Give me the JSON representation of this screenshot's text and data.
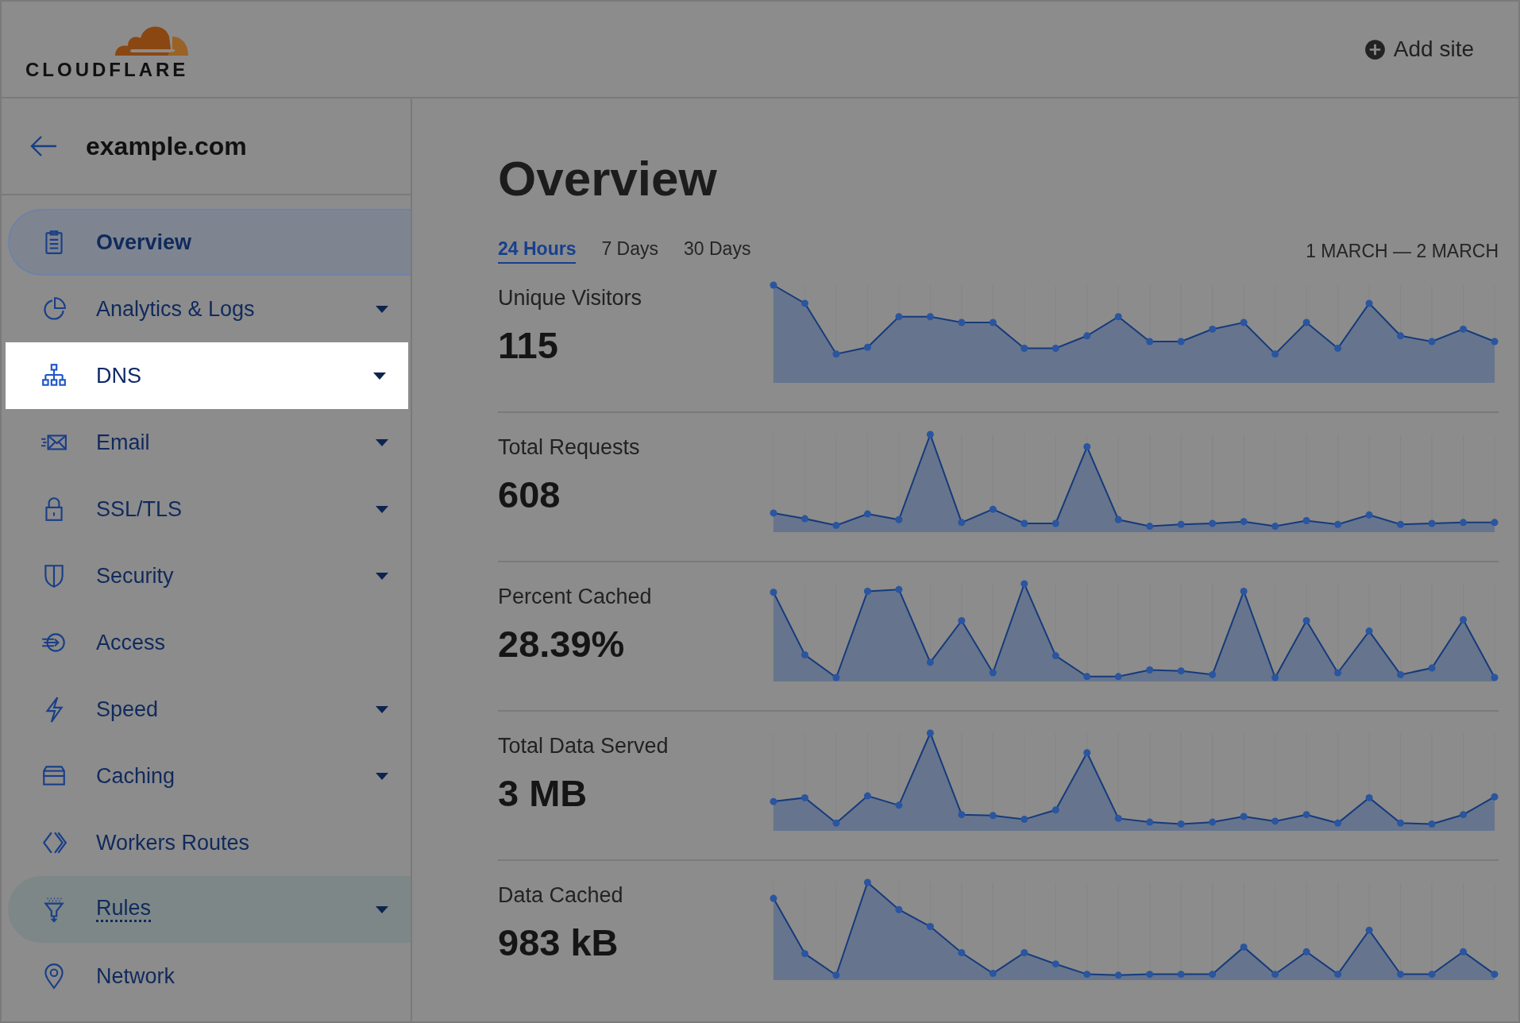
{
  "header": {
    "logo_text": "CLOUDFLARE",
    "add_site": "Add site"
  },
  "sidebar": {
    "domain": "example.com",
    "items": [
      {
        "label": "Overview",
        "selected": true,
        "highlighted": false,
        "hovered": false,
        "dropdown": false
      },
      {
        "label": "Analytics & Logs",
        "selected": false,
        "highlighted": false,
        "hovered": false,
        "dropdown": true
      },
      {
        "label": "DNS",
        "selected": false,
        "highlighted": true,
        "hovered": false,
        "dropdown": true
      },
      {
        "label": "Email",
        "selected": false,
        "highlighted": false,
        "hovered": false,
        "dropdown": true
      },
      {
        "label": "SSL/TLS",
        "selected": false,
        "highlighted": false,
        "hovered": false,
        "dropdown": true
      },
      {
        "label": "Security",
        "selected": false,
        "highlighted": false,
        "hovered": false,
        "dropdown": true
      },
      {
        "label": "Access",
        "selected": false,
        "highlighted": false,
        "hovered": false,
        "dropdown": false
      },
      {
        "label": "Speed",
        "selected": false,
        "highlighted": false,
        "hovered": false,
        "dropdown": true
      },
      {
        "label": "Caching",
        "selected": false,
        "highlighted": false,
        "hovered": false,
        "dropdown": true
      },
      {
        "label": "Workers Routes",
        "selected": false,
        "highlighted": false,
        "hovered": false,
        "dropdown": false
      },
      {
        "label": "Rules",
        "selected": false,
        "highlighted": false,
        "hovered": true,
        "dropdown": true
      },
      {
        "label": "Network",
        "selected": false,
        "highlighted": false,
        "hovered": false,
        "dropdown": false
      }
    ]
  },
  "main": {
    "title": "Overview",
    "tabs": [
      {
        "label": "24 Hours",
        "selected": true
      },
      {
        "label": "7 Days",
        "selected": false
      },
      {
        "label": "30 Days",
        "selected": false
      }
    ],
    "date_range": "1 MARCH — 2 MARCH",
    "metrics": [
      {
        "label": "Unique Visitors",
        "value": "115"
      },
      {
        "label": "Total Requests",
        "value": "608"
      },
      {
        "label": "Percent Cached",
        "value": "28.39%"
      },
      {
        "label": "Total Data Served",
        "value": "3 MB"
      },
      {
        "label": "Data Cached",
        "value": "983 kB"
      }
    ]
  }
}
